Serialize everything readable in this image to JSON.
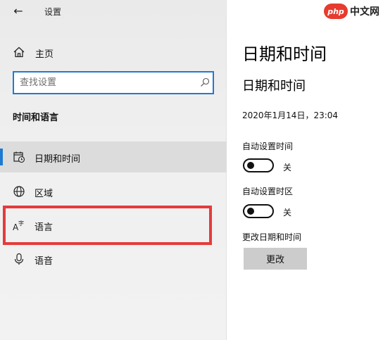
{
  "header": {
    "back_glyph": "←",
    "app_title": "设置"
  },
  "sidebar": {
    "home_label": "主页",
    "search": {
      "placeholder": "查找设置",
      "value": ""
    },
    "section_heading": "时间和语言",
    "items": [
      {
        "label": "日期和时间",
        "icon": "calendar-clock-icon",
        "active": true
      },
      {
        "label": "区域",
        "icon": "globe-icon",
        "active": false
      },
      {
        "label": "语言",
        "icon": "language-icon",
        "active": false
      },
      {
        "label": "语音",
        "icon": "microphone-icon",
        "active": false
      }
    ]
  },
  "content": {
    "page_title": "日期和时间",
    "sub_title": "日期和时间",
    "current_datetime": "2020年1月14日，23:04",
    "auto_time": {
      "label": "自动设置时间",
      "state": "关",
      "on": false
    },
    "auto_timezone": {
      "label": "自动设置时区",
      "state": "关",
      "on": false
    },
    "change_section_label": "更改日期和时间",
    "change_button_label": "更改"
  },
  "watermark": {
    "badge": "php",
    "text": "中文网"
  },
  "colors": {
    "accent": "#1f7ad1",
    "highlight": "#e53b3b",
    "sidebar_bg": "#eeeeee",
    "active_item_bg": "#dcdcdc",
    "button_bg": "#cccccc"
  }
}
